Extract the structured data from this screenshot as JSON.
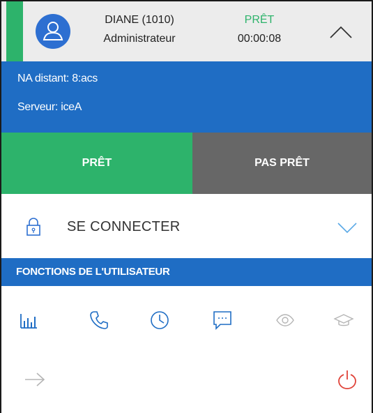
{
  "agent": {
    "name": "DIANE (1010)",
    "role": "Administrateur",
    "state": "PRÊT",
    "timer": "00:00:08"
  },
  "info": {
    "remote_line": "NA distant: 8:acs",
    "server_line": "Serveur: iceA"
  },
  "status_buttons": {
    "ready_label": "PRÊT",
    "not_ready_label": "PAS PRÊT"
  },
  "connect": {
    "label": "SE CONNECTER"
  },
  "user_functions": {
    "title": "FONCTIONS DE L'UTILISATEUR",
    "icons": [
      "bar-chart-icon",
      "phone-icon",
      "clock-icon",
      "chat-icon",
      "eye-icon",
      "graduation-cap-icon"
    ]
  },
  "footer_icons": [
    "arrow-right-icon",
    "power-icon"
  ],
  "colors": {
    "green": "#2db36b",
    "blue": "#1f6dc4",
    "gray": "#676767",
    "header_bg": "#ececec",
    "power_red": "#e0443a"
  }
}
